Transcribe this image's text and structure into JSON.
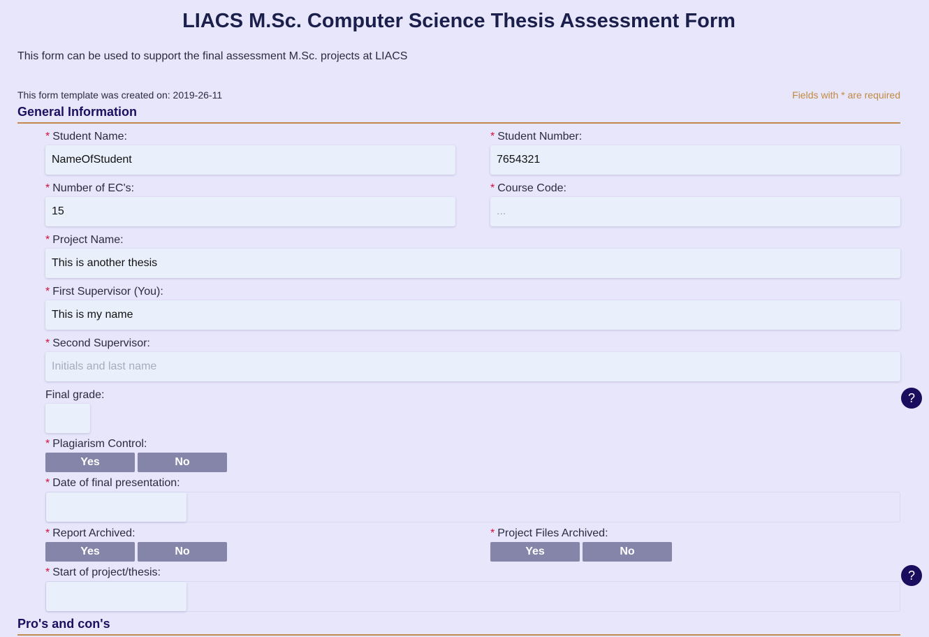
{
  "page": {
    "title": "LIACS M.Sc. Computer Science Thesis Assessment Form",
    "description": "This form can be used to support the final assessment M.Sc. projects at LIACS",
    "created_on": "This form template was created on: 2019-26-11",
    "required_note": "Fields with * are required"
  },
  "sections": {
    "general": "General Information",
    "pros_cons": "Pro's and con's"
  },
  "required_marker": "*",
  "fields": {
    "student_name": {
      "label": "Student Name:",
      "value": "NameOfStudent"
    },
    "student_number": {
      "label": "Student Number:",
      "value": "7654321"
    },
    "ecs": {
      "label": "Number of EC's:",
      "value": "15"
    },
    "course_code": {
      "label": "Course Code:",
      "placeholder": "..."
    },
    "project_name": {
      "label": "Project Name:",
      "value": "This is another thesis"
    },
    "first_supervisor": {
      "label": "First Supervisor (You):",
      "value": "This is my name"
    },
    "second_supervisor": {
      "label": "Second Supervisor:",
      "placeholder": "Initials and last name"
    },
    "final_grade": {
      "label": "Final grade:"
    },
    "plagiarism": {
      "label": "Plagiarism Control:"
    },
    "presentation_date": {
      "label": "Date of final presentation:"
    },
    "report_archived": {
      "label": "Report Archived:"
    },
    "files_archived": {
      "label": "Project Files Archived:"
    },
    "start_date": {
      "label": "Start of project/thesis:"
    }
  },
  "buttons": {
    "yes": "Yes",
    "no": "No"
  },
  "help_icon": {
    "glyph": "?",
    "color": "#1a0d5e"
  },
  "colors": {
    "background": "#e8e6fb",
    "accent": "#c08a50",
    "button": "#8584a9",
    "required": "#d0103a"
  }
}
